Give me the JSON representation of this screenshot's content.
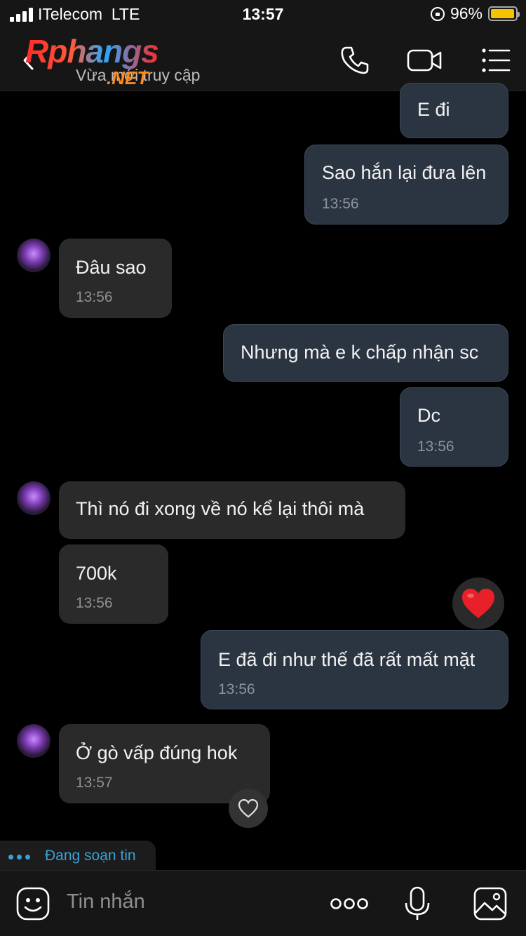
{
  "status_bar": {
    "carrier": "ITelecom",
    "network": "LTE",
    "time": "13:57",
    "battery_percent": "96%",
    "battery_level": 0.96
  },
  "header": {
    "logo_main": "Rphangs",
    "logo_suffix": ".NET",
    "subtitle": "Vừa mới truy cập",
    "icons": [
      "back-icon",
      "phone-icon",
      "video-camera-icon",
      "menu-icon"
    ]
  },
  "messages": [
    {
      "direction": "out",
      "text": "E đi",
      "time": ""
    },
    {
      "direction": "out",
      "text": "Sao hắn lại đưa lên",
      "time": "13:56"
    },
    {
      "direction": "in",
      "text": "Đâu sao",
      "time": "13:56"
    },
    {
      "direction": "out",
      "text": "Nhưng mà e k chấp nhận sc",
      "time": ""
    },
    {
      "direction": "out",
      "text": "Dc",
      "time": "13:56"
    },
    {
      "direction": "in",
      "text": "Thì nó đi xong về nó kể lại thôi mà",
      "time": ""
    },
    {
      "direction": "in",
      "text": "700k",
      "time": "13:56"
    },
    {
      "direction": "out",
      "text": "E đã đi như thế đã rất mất mặt",
      "time": "13:56",
      "reaction": "red-heart-icon"
    },
    {
      "direction": "in",
      "text": "Ở gò vấp đúng hok",
      "time": "13:57",
      "reaction": "heart-outline-icon"
    }
  ],
  "typing_indicator": "Đang soạn tin",
  "input_bar": {
    "placeholder": "Tin nhắn",
    "icons": [
      "sticker-icon",
      "more-icon",
      "microphone-icon",
      "image-icon"
    ]
  },
  "colors": {
    "background": "#000000",
    "outgoing_bubble": "#2b3542",
    "incoming_bubble": "#2a2a2a",
    "typing_accent": "#3aa0d8",
    "battery": "#f5c400",
    "heart": "#e8202a"
  }
}
